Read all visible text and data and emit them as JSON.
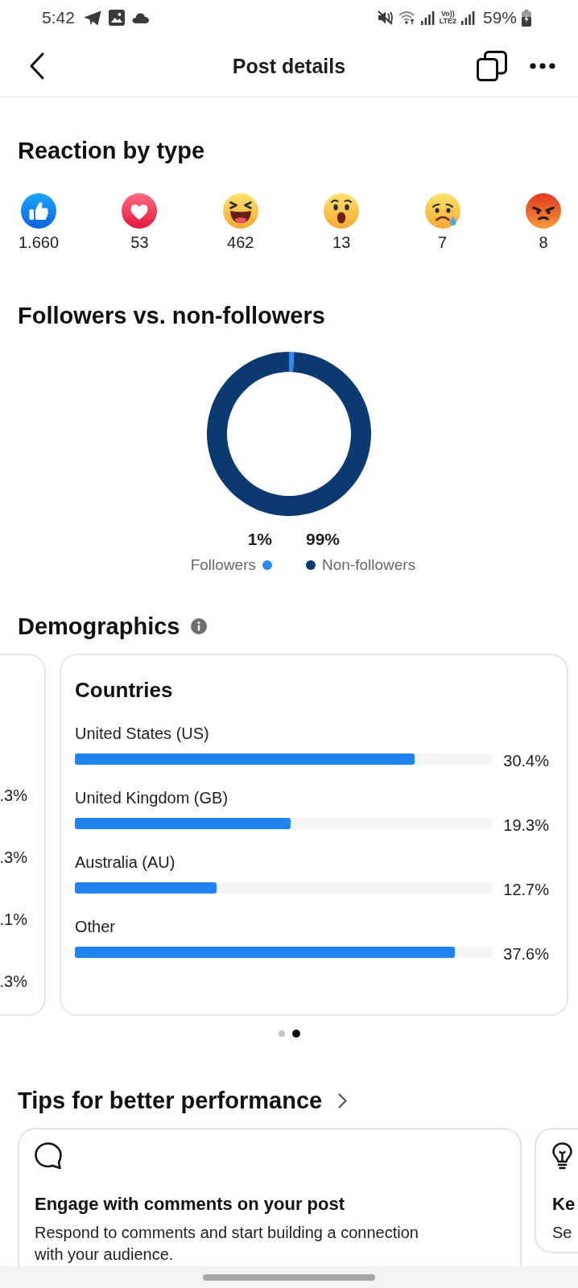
{
  "status_bar": {
    "time": "5:42",
    "network": [
      "Vo))",
      "LTE2"
    ],
    "battery": "59%"
  },
  "header": {
    "title": "Post details"
  },
  "reactions": {
    "title": "Reaction by type",
    "items": [
      {
        "kind": "like",
        "count": "1.660"
      },
      {
        "kind": "love",
        "count": "53"
      },
      {
        "kind": "haha",
        "count": "462"
      },
      {
        "kind": "wow",
        "count": "13"
      },
      {
        "kind": "sad",
        "count": "7"
      },
      {
        "kind": "angry",
        "count": "8"
      }
    ]
  },
  "followers": {
    "title": "Followers vs. non-followers",
    "chart_data": {
      "type": "donut",
      "categories": [
        "Followers",
        "Non-followers"
      ],
      "values": [
        1,
        99
      ]
    },
    "legend": [
      {
        "value": "1%",
        "color": "#2d88f0"
      },
      {
        "value": "99%",
        "color": "#0b3a70"
      }
    ]
  },
  "demographics": {
    "title": "Demographics",
    "cards": [
      {
        "kind": "partial",
        "values": [
          ".3%",
          ".3%",
          ".1%",
          ".3%"
        ]
      },
      {
        "kind": "bars",
        "title": "Countries",
        "rows": [
          {
            "label": "United States (US)",
            "value": "30.4%",
            "level": 0.815
          },
          {
            "label": "United Kingdom (GB)",
            "value": "19.3%",
            "level": 0.517
          },
          {
            "label": "Australia (AU)",
            "value": "12.7%",
            "level": 0.34
          },
          {
            "label": "Other",
            "value": "37.6%",
            "level": 0.911
          }
        ]
      }
    ],
    "pages": [
      {
        "selected": false
      },
      {
        "selected": true
      }
    ]
  },
  "tips": {
    "title": "Tips for better performance",
    "cards": [
      {
        "kind": "comment",
        "title": "Engage with comments on your post",
        "description": "Respond to comments and start building a connection with your audience."
      },
      {
        "kind": "idea",
        "title": "Ke",
        "description": "Se"
      }
    ]
  }
}
